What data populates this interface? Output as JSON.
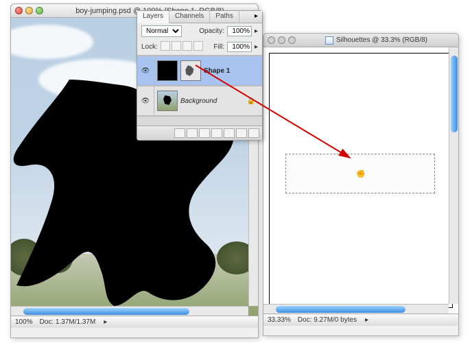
{
  "win1": {
    "title": "boy-jumping.psd @ 100% (Shape 1, RGB/8)",
    "zoom": "100%",
    "doc": "Doc: 1.37M/1.37M"
  },
  "win2": {
    "title": "Silhouettes @ 33.3% (RGB/8)",
    "zoom": "33.33%",
    "doc": "Doc: 9.27M/0 bytes"
  },
  "palette": {
    "tabs": [
      "Layers",
      "Channels",
      "Paths"
    ],
    "blend": "Normal",
    "opacityLabel": "Opacity:",
    "opacity": "100%",
    "lockLabel": "Lock:",
    "fillLabel": "Fill:",
    "fill": "100%",
    "layers": [
      {
        "name": "Shape 1",
        "selected": true
      },
      {
        "name": "Background",
        "locked": true
      }
    ]
  }
}
